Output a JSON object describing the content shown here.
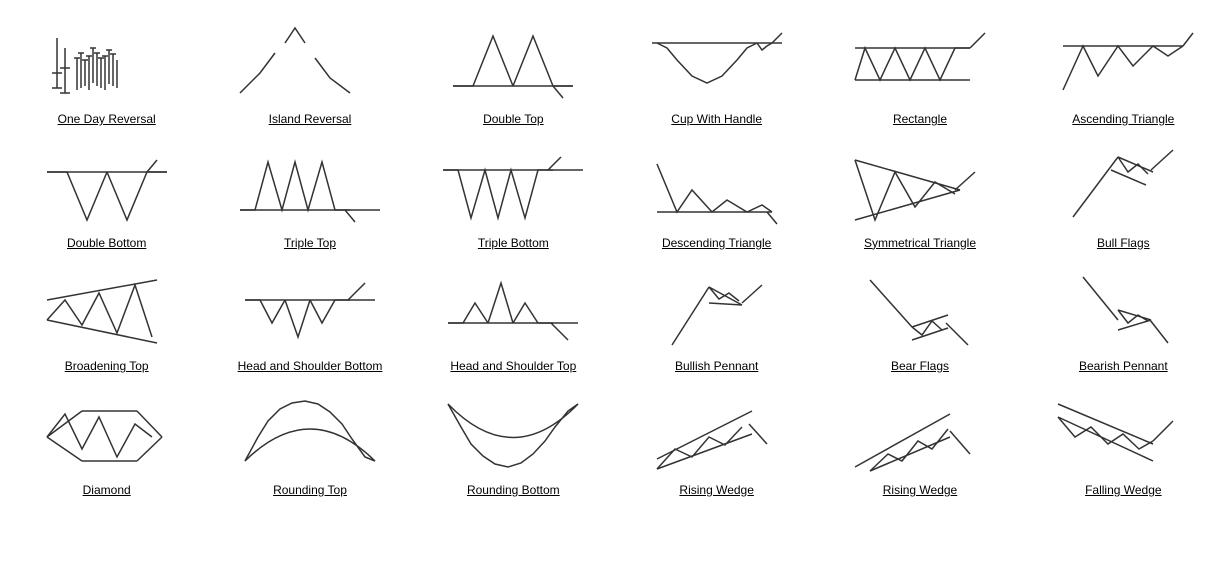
{
  "patterns": [
    {
      "id": "one-day-reversal",
      "label": "One Day Reversal"
    },
    {
      "id": "island-reversal",
      "label": "Island Reversal"
    },
    {
      "id": "double-top",
      "label": "Double Top"
    },
    {
      "id": "cup-with-handle",
      "label": "Cup With Handle"
    },
    {
      "id": "rectangle",
      "label": "Rectangle"
    },
    {
      "id": "ascending-triangle",
      "label": "Ascending Triangle"
    },
    {
      "id": "double-bottom",
      "label": "Double Bottom"
    },
    {
      "id": "triple-top",
      "label": "Triple Top"
    },
    {
      "id": "triple-bottom",
      "label": "Triple Bottom"
    },
    {
      "id": "descending-triangle",
      "label": "Descending Triangle"
    },
    {
      "id": "symmetrical-triangle",
      "label": "Symmetrical Triangle"
    },
    {
      "id": "bull-flags",
      "label": "Bull Flags"
    },
    {
      "id": "broadening-top",
      "label": "Broadening Top"
    },
    {
      "id": "head-shoulder-bottom",
      "label": "Head and Shoulder Bottom"
    },
    {
      "id": "head-shoulder-top",
      "label": "Head and Shoulder Top"
    },
    {
      "id": "bullish-pennant",
      "label": "Bullish Pennant"
    },
    {
      "id": "bear-flags",
      "label": "Bear Flags"
    },
    {
      "id": "bearish-pennant",
      "label": "Bearish Pennant"
    },
    {
      "id": "diamond",
      "label": "Diamond"
    },
    {
      "id": "rounding-top",
      "label": "Rounding Top"
    },
    {
      "id": "rounding-bottom",
      "label": "Rounding Bottom"
    },
    {
      "id": "rising-wedge-1",
      "label": "Rising Wedge"
    },
    {
      "id": "rising-wedge-2",
      "label": "Rising Wedge"
    },
    {
      "id": "falling-wedge",
      "label": "Falling Wedge"
    }
  ]
}
